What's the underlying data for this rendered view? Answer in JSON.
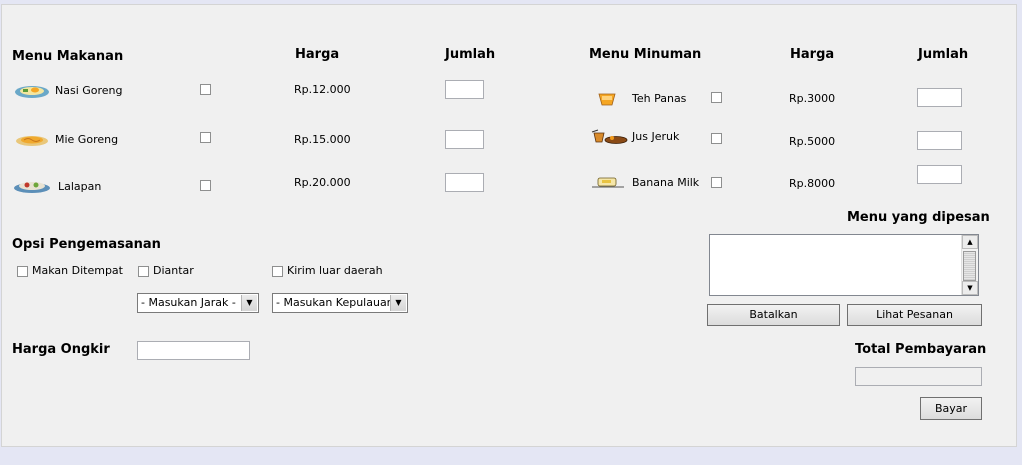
{
  "food": {
    "header": "Menu Makanan",
    "price_header": "Harga",
    "qty_header": "Jumlah",
    "items": [
      {
        "name": "Nasi Goreng",
        "price": "Rp.12.000"
      },
      {
        "name": "Mie Goreng",
        "price": "Rp.15.000"
      },
      {
        "name": "Lalapan",
        "price": "Rp.20.000"
      }
    ]
  },
  "drinks": {
    "header": "Menu Minuman",
    "price_header": "Harga",
    "qty_header": "Jumlah",
    "items": [
      {
        "name": "Teh Panas",
        "price": "Rp.3000"
      },
      {
        "name": "Jus Jeruk",
        "price": "Rp.5000"
      },
      {
        "name": "Banana Milk",
        "price": "Rp.8000"
      }
    ]
  },
  "packaging": {
    "header": "Opsi Pengemasanan",
    "options": [
      "Makan Ditempat",
      "Diantar",
      "Kirim luar daerah"
    ],
    "distance_select": "- Masukan Jarak -",
    "island_select": "- Masukan Kepulauan -"
  },
  "shipping": {
    "label": "Harga Ongkir",
    "value": ""
  },
  "order": {
    "header": "Menu yang dipesan",
    "cancel_button": "Batalkan",
    "view_button": "Lihat Pesanan"
  },
  "payment": {
    "header": "Total Pembayaran",
    "total_value": "",
    "pay_button": "Bayar"
  }
}
